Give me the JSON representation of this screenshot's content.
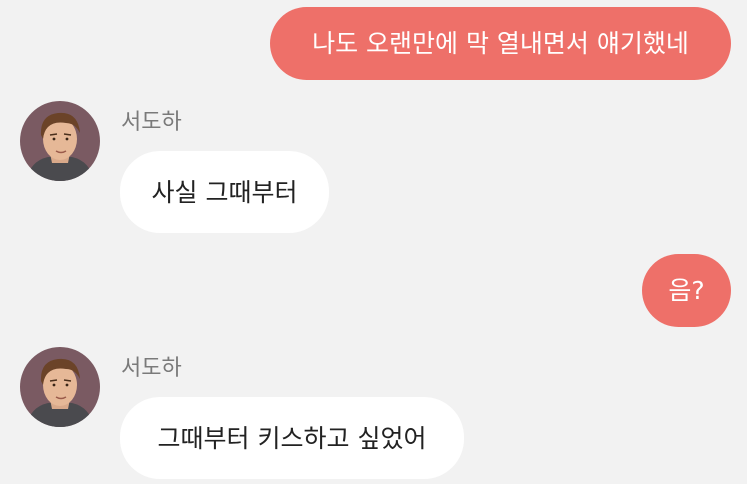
{
  "conversation": {
    "messages": [
      {
        "type": "sent",
        "text": "나도 오랜만에 막 열내면서 얘기했네"
      },
      {
        "type": "received",
        "sender": "서도하",
        "text": "사실 그때부터",
        "avatar": "male-portrait-avatar"
      },
      {
        "type": "sent",
        "text": "음?"
      },
      {
        "type": "received",
        "sender": "서도하",
        "text": "그때부터 키스하고 싶었어",
        "avatar": "male-portrait-avatar"
      }
    ]
  },
  "colors": {
    "background": "#f2f2f2",
    "sent_bubble": "#ee7069",
    "received_bubble": "#ffffff",
    "sender_name": "#7a7a7a"
  }
}
